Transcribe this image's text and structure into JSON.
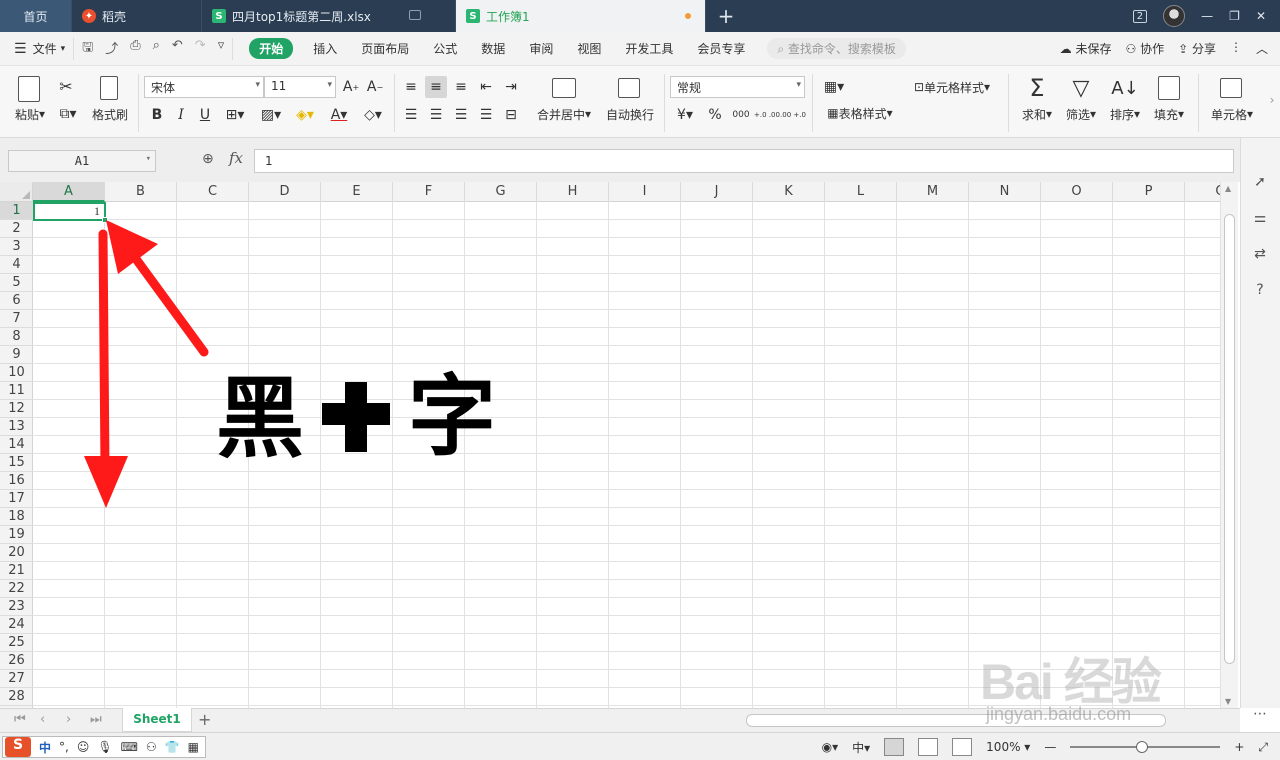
{
  "tabs": {
    "home": "首页",
    "daoke": "稻壳",
    "file1": "四月top1标题第二周.xlsx",
    "active": "工作簿1",
    "window_badge": "2"
  },
  "menu": {
    "file": "文件",
    "items": [
      "开始",
      "插入",
      "页面布局",
      "公式",
      "数据",
      "审阅",
      "视图",
      "开发工具",
      "会员专享"
    ],
    "search_placeholder": "查找命令、搜索模板",
    "unsaved": "未保存",
    "collab": "协作",
    "share": "分享"
  },
  "ribbon": {
    "paste": "粘贴",
    "format_painter": "格式刷",
    "font_name": "宋体",
    "font_size": "11",
    "merge_center": "合并居中",
    "wrap_text": "自动换行",
    "number_format": "常规",
    "cell_style": "单元格样式",
    "table_style": "表格样式",
    "sum": "求和",
    "filter": "筛选",
    "sort": "排序",
    "fill": "填充",
    "cells": "单元格",
    "bold": "B",
    "italic": "I",
    "underline": "U",
    "percent": "%",
    "thousands": "000",
    "inc_dec": "+.0 .00",
    "dec_dec": ".00 +.0"
  },
  "formula_bar": {
    "name_box": "A1",
    "fx": "fx",
    "value": "1"
  },
  "grid": {
    "columns": [
      "A",
      "B",
      "C",
      "D",
      "E",
      "F",
      "G",
      "H",
      "I",
      "J",
      "K",
      "L",
      "M",
      "N",
      "O",
      "P",
      "Q"
    ],
    "rows": [
      "1",
      "2",
      "3",
      "4",
      "5",
      "6",
      "7",
      "8",
      "9",
      "10",
      "11",
      "12",
      "13",
      "14",
      "15",
      "16",
      "17",
      "18",
      "19",
      "20",
      "21",
      "22",
      "23",
      "24",
      "25",
      "26",
      "27",
      "28"
    ],
    "selected_cell": "A1",
    "a1_value": "1"
  },
  "annotation": {
    "char1": "黑",
    "char2": "字",
    "arrow_color": "#ff1a1a"
  },
  "sheets": {
    "active": "Sheet1"
  },
  "status": {
    "zoom": "100%",
    "ime_zh": "中"
  },
  "watermark": {
    "line1": "Bai 经验",
    "line2": "jingyan.baidu.com"
  },
  "colors": {
    "accent": "#21a366",
    "tabbar": "#2a3d52"
  }
}
